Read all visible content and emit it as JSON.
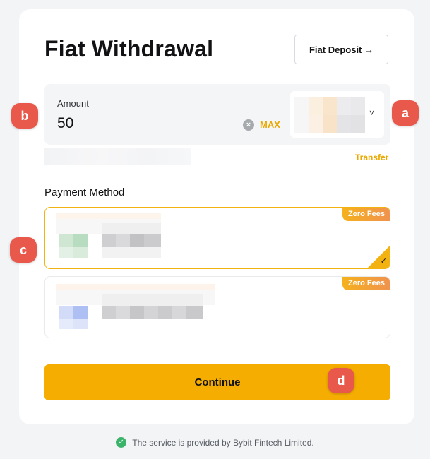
{
  "page": {
    "title": "Fiat Withdrawal",
    "deposit_button": "Fiat Deposit →"
  },
  "amount": {
    "label": "Amount",
    "value": "50",
    "clear_icon": "x-circle-icon",
    "max_label": "MAX",
    "currency_chevron": "˅"
  },
  "transfer_label": "Transfer",
  "payment": {
    "label": "Payment Method",
    "methods": [
      {
        "badge": "Zero Fees",
        "selected": true
      },
      {
        "badge": "Zero Fees",
        "selected": false
      }
    ],
    "check_mark": "✓"
  },
  "continue_label": "Continue",
  "footer": {
    "text": "The service is provided by Bybit Fintech Limited.",
    "icon": "shield-check-icon"
  },
  "markers": {
    "a": "a",
    "b": "b",
    "c": "c",
    "d": "d"
  },
  "colors": {
    "accent": "#f4ad00",
    "accent_text": "#e9a900",
    "marker": "#e8584b",
    "badge_gradient": [
      "#f5b11c",
      "#f0924f"
    ]
  }
}
